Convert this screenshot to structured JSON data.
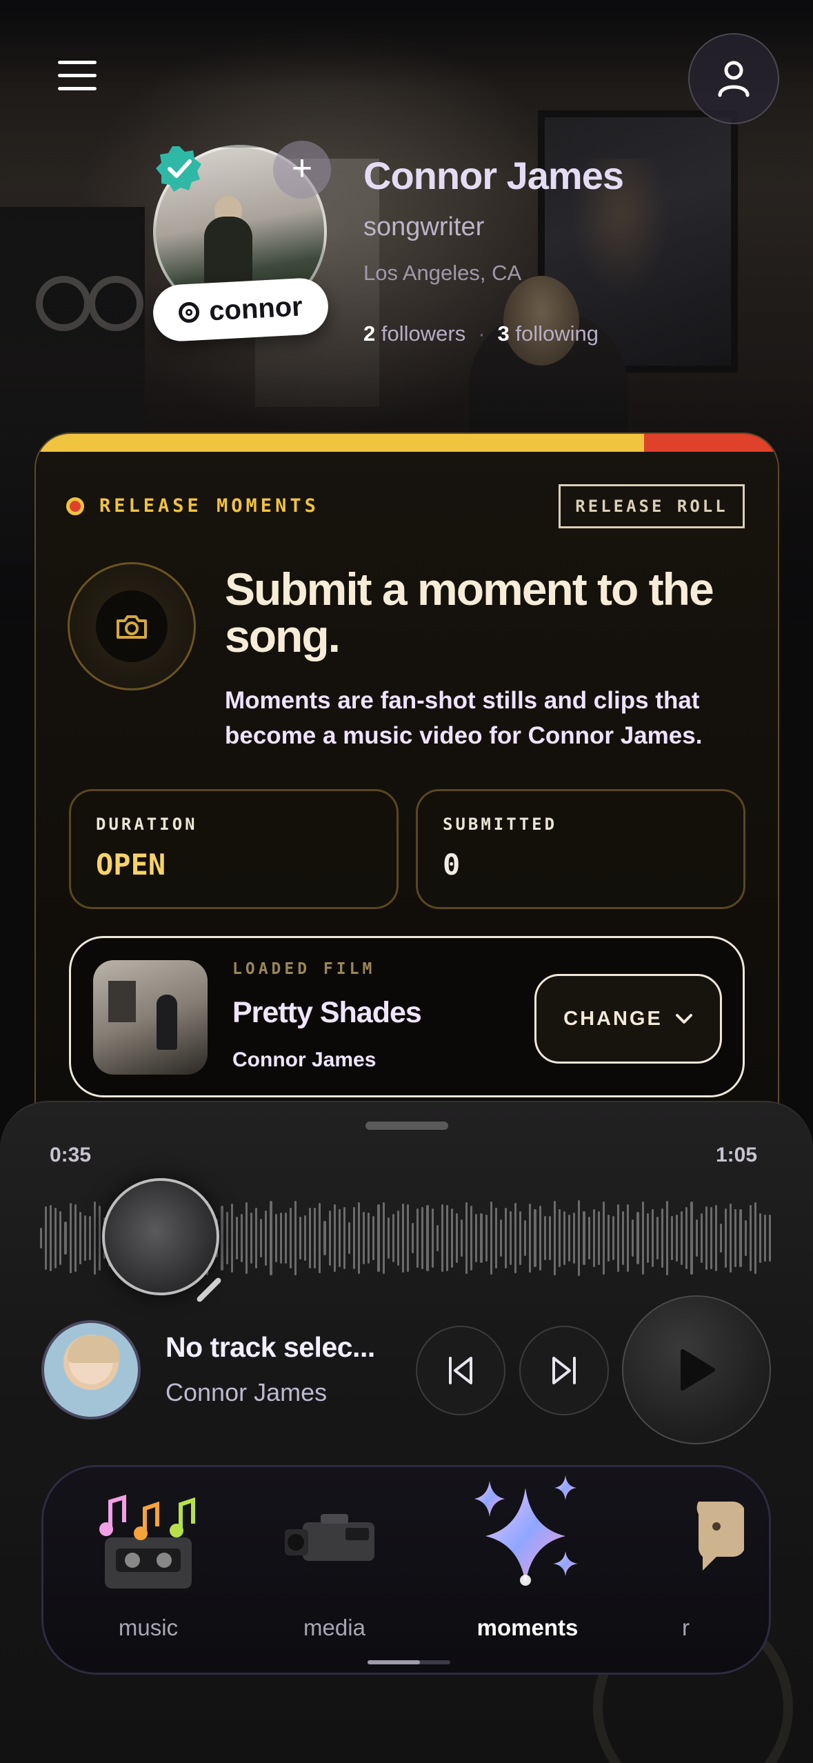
{
  "profile": {
    "name": "Connor James",
    "role": "songwriter",
    "location": "Los Angeles, CA",
    "handle": "connor",
    "followers_count": "2",
    "followers_label": "followers",
    "following_count": "3",
    "following_label": "following",
    "separator": "·"
  },
  "release": {
    "eyebrow": "RELEASE MOMENTS",
    "roll_button": "RELEASE ROLL",
    "headline": "Submit a moment to the song.",
    "description": "Moments are fan-shot stills and clips that become a music video for Connor James.",
    "stats": [
      {
        "label": "DURATION",
        "value": "OPEN",
        "color": "#f6d36a"
      },
      {
        "label": "SUBMITTED",
        "value": "0",
        "color": "#f1ece3"
      }
    ],
    "film": {
      "label": "LOADED FILM",
      "title": "Pretty Shades",
      "artist": "Connor James",
      "change_button": "CHANGE"
    },
    "colors": {
      "accent_yellow": "#f0c43f",
      "accent_red": "#e0412b"
    }
  },
  "player": {
    "elapsed": "0:35",
    "duration": "1:05",
    "now_playing_title": "No track selec...",
    "now_playing_artist": "Connor James"
  },
  "tabs": [
    {
      "label": "music",
      "icon": "cassette-notes-icon",
      "active": false
    },
    {
      "label": "media",
      "icon": "camcorder-icon",
      "active": false
    },
    {
      "label": "moments",
      "icon": "sparkles-icon",
      "active": true
    },
    {
      "label": "r",
      "icon": "chat-bubble-icon",
      "active": false
    }
  ]
}
